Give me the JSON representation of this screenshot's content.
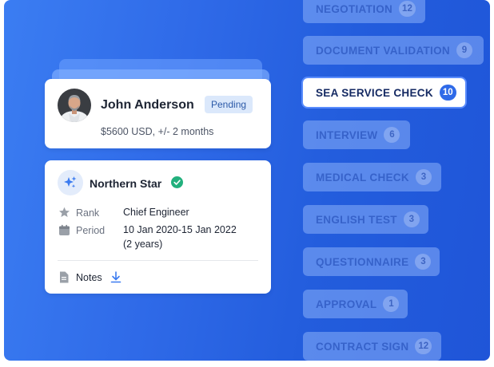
{
  "candidate": {
    "name": "John Anderson",
    "status": "Pending",
    "salary": "$5600 USD, +/- 2 months"
  },
  "experience": {
    "ship": "Northern Star",
    "rank_label": "Rank",
    "rank_value": "Chief Engineer",
    "period_label": "Period",
    "period_value": "10 Jan 2020-15 Jan 2022",
    "period_duration": "(2 years)",
    "notes_label": "Notes"
  },
  "stages": [
    {
      "label": "NEGOTIATION",
      "count": "12"
    },
    {
      "label": "DOCUMENT VALIDATION",
      "count": "9"
    },
    {
      "label": "SEA SERVICE CHECK",
      "count": "10",
      "active": true
    },
    {
      "label": "INTERVIEW",
      "count": "6"
    },
    {
      "label": "MEDICAL CHECK",
      "count": "3"
    },
    {
      "label": "ENGLISH TEST",
      "count": "3"
    },
    {
      "label": "QUESTIONNAIRE",
      "count": "3"
    },
    {
      "label": "APPROVAL",
      "count": "1"
    },
    {
      "label": "CONTRACT SIGN",
      "count": "12"
    }
  ],
  "icons": {
    "avatar": "avatar-photo",
    "experience": "sparkle-icon",
    "verified": "check-circle-icon",
    "rank": "star-icon",
    "period": "calendar-icon",
    "notes": "document-icon",
    "download": "download-icon"
  },
  "colors": {
    "background": "#2f6ae8",
    "accent": "#2f6ae8",
    "verified": "#22b07d",
    "badge_bg": "#dbe8fb"
  }
}
